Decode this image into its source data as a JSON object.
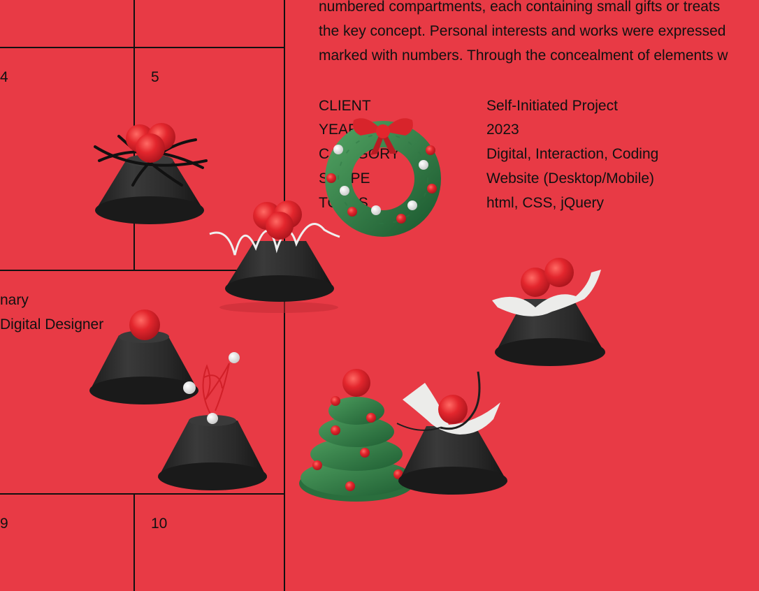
{
  "project": {
    "intro_lines": [
      "numbered compartments, each containing small gifts or treats",
      "the key concept. Personal interests and works were expressed",
      "marked with numbers. Through the concealment of elements w"
    ],
    "info": [
      {
        "label": "CLIENT",
        "value": "Self-Initiated Project"
      },
      {
        "label": "YEAR",
        "value": "2023"
      },
      {
        "label": "CATEGORY",
        "value": "Digital, Interaction, Coding"
      },
      {
        "label": "SCOPE",
        "value": "Website (Desktop/Mobile)"
      },
      {
        "label": "TOOLS",
        "value": "html, CSS, jQuery"
      }
    ]
  },
  "calendar": {
    "cells": [
      "4",
      "5",
      "9",
      "10"
    ]
  },
  "profile": {
    "line1": "nary",
    "line2": "Digital Designer"
  },
  "decorations": [
    "cake-crossed-sticks-icon",
    "cake-wavy-ribbon-icon",
    "wreath-icon",
    "cake-paper-banner-icon",
    "cake-single-berry-icon",
    "cake-signature-icon",
    "christmas-tree-icon",
    "cake-paper-wire-icon"
  ],
  "colors": {
    "background": "#e83a45",
    "ink": "#111111",
    "cake": "#2b2b2b",
    "berry": "#e3262d",
    "wreath": "#2f7a45",
    "paper": "#e8e8e6"
  }
}
